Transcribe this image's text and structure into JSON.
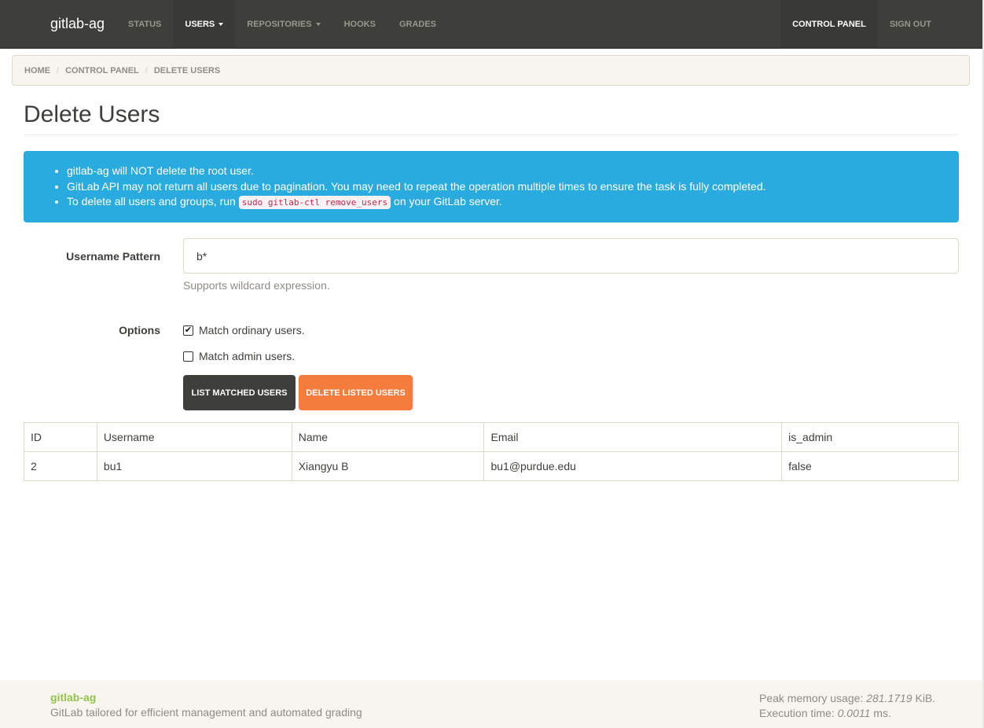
{
  "navbar": {
    "brand": "gitlab-ag",
    "items": [
      {
        "label": "STATUS",
        "caret": false
      },
      {
        "label": "USERS",
        "caret": true
      },
      {
        "label": "REPOSITORIES",
        "caret": true
      },
      {
        "label": "HOOKS",
        "caret": false
      },
      {
        "label": "GRADES",
        "caret": false
      }
    ],
    "right_items": [
      {
        "label": "CONTROL PANEL"
      },
      {
        "label": "SIGN OUT"
      }
    ]
  },
  "breadcrumb": [
    "HOME",
    "CONTROL PANEL",
    "DELETE USERS"
  ],
  "page": {
    "title": "Delete Users"
  },
  "alert": {
    "items": [
      "gitlab-ag will NOT delete the root user.",
      "GitLab API may not return all users due to pagination. You may need to repeat the operation multiple times to ensure the task is fully completed."
    ],
    "item3_prefix": "To delete all users and groups, run",
    "item3_code": "sudo gitlab-ctl remove_users",
    "item3_suffix": "on your GitLab server."
  },
  "form": {
    "pattern_label": "Username Pattern",
    "pattern_value": "b*",
    "pattern_help": "Supports wildcard expression.",
    "options_label": "Options",
    "match_ordinary_label": "Match ordinary users.",
    "match_ordinary_checked": true,
    "match_admin_label": "Match admin users.",
    "match_admin_checked": false,
    "list_button": "LIST MATCHED USERS",
    "delete_button": "DELETE LISTED USERS"
  },
  "table": {
    "headers": [
      "ID",
      "Username",
      "Name",
      "Email",
      "is_admin"
    ],
    "rows": [
      [
        "2",
        "bu1",
        "Xiangyu B",
        "bu1@purdue.edu",
        "false"
      ]
    ]
  },
  "footer": {
    "brand": "gitlab-ag",
    "tagline": "GitLab tailored for efficient management and automated grading",
    "memory_label": "Peak memory usage:",
    "memory_value": "281.1719",
    "memory_unit": "KiB.",
    "exec_label": "Execution time:",
    "exec_value": "0.0011",
    "exec_unit": "ms."
  },
  "colors": {
    "navbar": "#3e3f3a",
    "alert": "#29abe0",
    "warning": "#f47c3c",
    "brand_green": "#93c54b"
  }
}
